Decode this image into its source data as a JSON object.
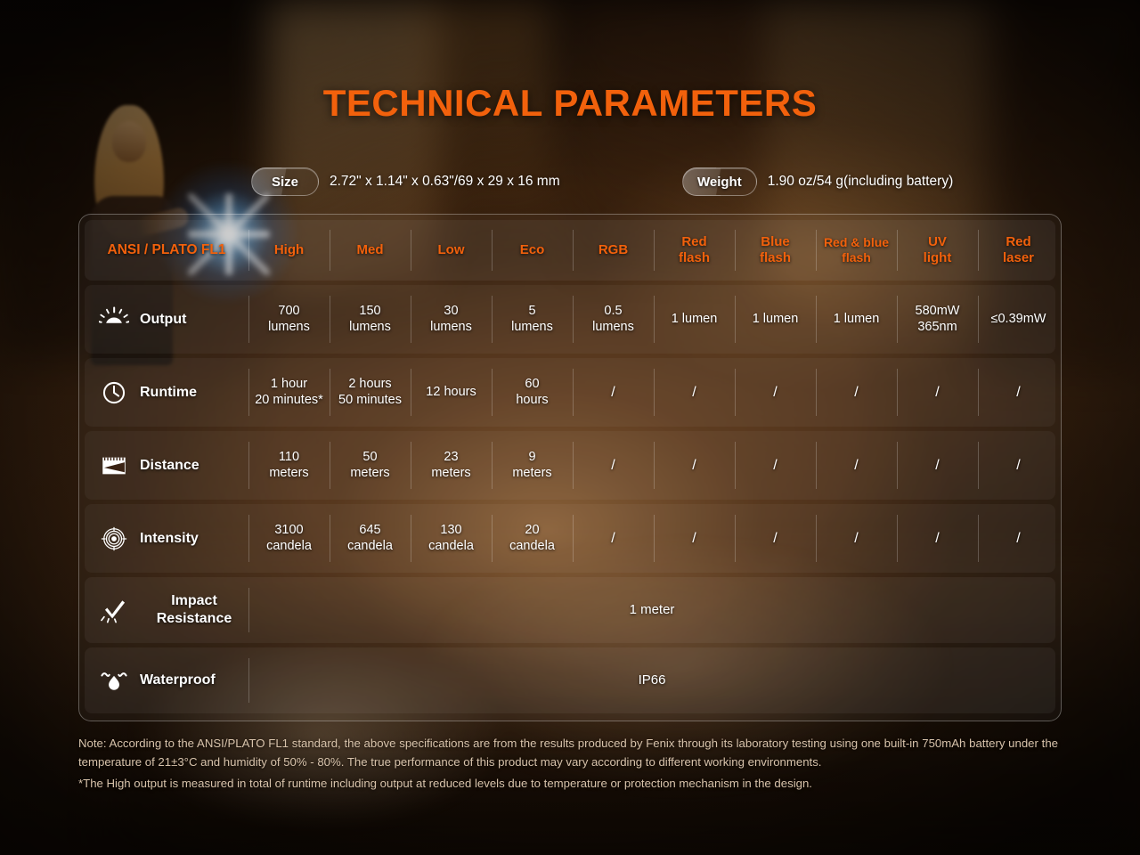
{
  "title": "TECHNICAL PARAMETERS",
  "specs": {
    "size_label": "Size",
    "size_value": "2.72\" x 1.14\" x 0.63\"/69 x 29 x 16 mm",
    "weight_label": "Weight",
    "weight_value": "1.90 oz/54 g(including battery)"
  },
  "colors": {
    "accent": "#f2610c",
    "text": "#ffffff",
    "note": "#d8c3ab"
  },
  "table": {
    "headers": [
      "ANSI / PLATO FL1",
      "High",
      "Med",
      "Low",
      "Eco",
      "RGB",
      "Red\nflash",
      "Blue\nflash",
      "Red & blue\nflash",
      "UV\nlight",
      "Red\nlaser"
    ],
    "rows": [
      {
        "icon": "sunburst-icon",
        "label": "Output",
        "values": [
          "700\nlumens",
          "150\nlumens",
          "30\nlumens",
          "5\nlumens",
          "0.5\nlumens",
          "1 lumen",
          "1 lumen",
          "1 lumen",
          "580mW\n365nm",
          "≤0.39mW"
        ]
      },
      {
        "icon": "clock-icon",
        "label": "Runtime",
        "values": [
          "1 hour\n20 minutes*",
          "2 hours\n50 minutes",
          "12 hours",
          "60\nhours",
          "/",
          "/",
          "/",
          "/",
          "/",
          "/"
        ]
      },
      {
        "icon": "ruler-beam-icon",
        "label": "Distance",
        "values": [
          "110\nmeters",
          "50\nmeters",
          "23\nmeters",
          "9\nmeters",
          "/",
          "/",
          "/",
          "/",
          "/",
          "/"
        ]
      },
      {
        "icon": "target-icon",
        "label": "Intensity",
        "values": [
          "3100\ncandela",
          "645\ncandela",
          "130\ncandela",
          "20\ncandela",
          "/",
          "/",
          "/",
          "/",
          "/",
          "/"
        ]
      }
    ],
    "wide_rows": [
      {
        "icon": "impact-icon",
        "label": "Impact Resistance",
        "value": "1 meter"
      },
      {
        "icon": "waterdrop-icon",
        "label": "Waterproof",
        "value": "IP66"
      }
    ]
  },
  "note": {
    "line1": "Note: According to the ANSI/PLATO FL1 standard, the above specifications are from the results produced by Fenix through its laboratory testing using one built-in 750mAh battery under the temperature of 21±3°C and humidity of 50% - 80%. The true performance of this product may vary according to different working environments.",
    "line2": "*The High output is measured in total of runtime including output at reduced levels due to temperature or protection mechanism in the design."
  }
}
